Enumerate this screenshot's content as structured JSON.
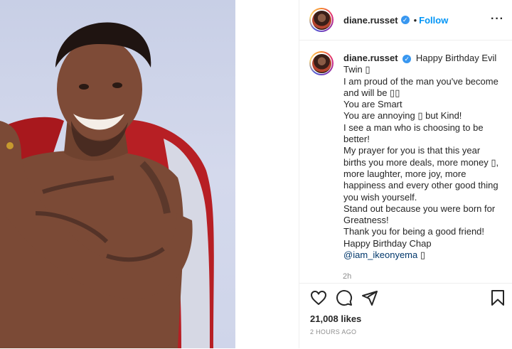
{
  "post": {
    "username": "diane.russet",
    "follow_label": "Follow",
    "separator": "•",
    "more_label": "···"
  },
  "caption": {
    "username": "diane.russet",
    "lines": [
      "Happy Birthday Evil",
      "Twin ▯",
      "I am proud of the man you've become",
      "and will be ▯▯",
      "You are Smart",
      "You are annoying ▯ but Kind!",
      "I see a man who is choosing to be",
      "better!",
      "My prayer for you is that this year",
      "births you more deals, more money ▯,",
      "more laughter, more joy, more",
      "happiness and every other good thing",
      "you wish yourself.",
      "Stand out because you were born for",
      "Greatness!",
      "Thank you for being a good friend!",
      "Happy Birthday Chap"
    ],
    "mention": "@iam_ikeonyema",
    "mention_suffix": " ▯",
    "time": "2h"
  },
  "actions": {
    "like_icon": "heart-icon",
    "comment_icon": "comment-icon",
    "share_icon": "share-icon",
    "save_icon": "bookmark-icon"
  },
  "stats": {
    "likes": "21,008 likes",
    "posted": "2 HOURS AGO"
  },
  "colors": {
    "follow": "#0095f6",
    "verified": "#3897f0",
    "mention": "#00376b",
    "muted": "#8e8e8e"
  }
}
